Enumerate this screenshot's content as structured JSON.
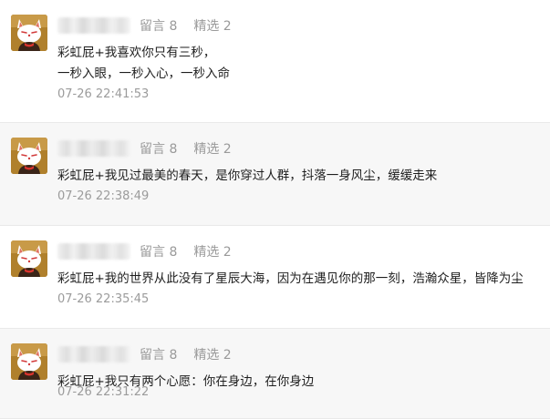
{
  "comments": [
    {
      "count_label": "留言 8",
      "select_label": "精选 2",
      "lines": [
        "彩虹屁+我喜欢你只有三秒，",
        "一秒入眼，一秒入心，一秒入命"
      ],
      "time": "07-26 22:41:53"
    },
    {
      "count_label": "留言 8",
      "select_label": "精选 2",
      "lines": [
        "彩虹屁+我见过最美的春天，是你穿过人群，抖落一身风尘，缓缓走来"
      ],
      "time": "07-26 22:38:49"
    },
    {
      "count_label": "留言 8",
      "select_label": "精选 2",
      "lines": [
        "彩虹屁+我的世界从此没有了星辰大海，因为在遇见你的那一刻，浩瀚众星，皆降为尘"
      ],
      "time": "07-26 22:35:45"
    },
    {
      "count_label": "留言 8",
      "select_label": "精选 2",
      "lines": [
        "彩虹屁+我只有两个心愿：你在身边，在你身边"
      ],
      "time": "07-26 22:31:22"
    }
  ],
  "avatar_icon": "fox-mask-cat-icon",
  "colors": {
    "meta_text": "#9a9a9a",
    "content_text": "#1e1e1e",
    "time_text": "#9b9b9b",
    "row_bg_alt": "#f7f7f7"
  }
}
